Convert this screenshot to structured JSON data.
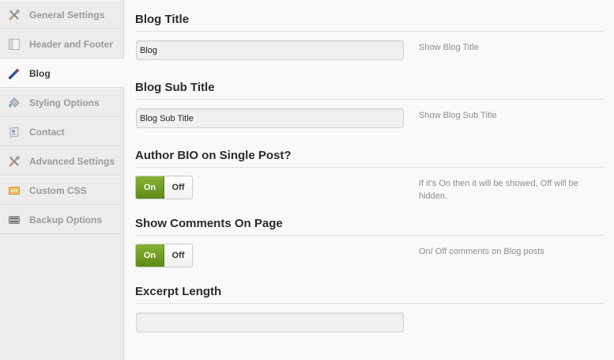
{
  "sidebar": {
    "items": [
      {
        "label": "General Settings",
        "icon": "tools-icon",
        "active": false
      },
      {
        "label": "Header and Footer",
        "icon": "layout-icon",
        "active": false
      },
      {
        "label": "Blog",
        "icon": "pen-icon",
        "active": true
      },
      {
        "label": "Styling Options",
        "icon": "paint-bucket-icon",
        "active": false
      },
      {
        "label": "Contact",
        "icon": "contact-card-icon",
        "active": false
      },
      {
        "label": "Advanced Settings",
        "icon": "tools-icon",
        "active": false
      },
      {
        "label": "Custom CSS",
        "icon": "css-file-icon",
        "active": false
      },
      {
        "label": "Backup Options",
        "icon": "drive-icon",
        "active": false
      }
    ]
  },
  "main": {
    "blog_title": {
      "heading": "Blog Title",
      "value": "Blog",
      "help": "Show Blog Title"
    },
    "blog_sub_title": {
      "heading": "Blog Sub Title",
      "value": "Blog Sub Title",
      "help": "Show Blog Sub Title"
    },
    "author_bio": {
      "heading": "Author BIO on Single Post?",
      "on_label": "On",
      "off_label": "Off",
      "state": "on",
      "help": "If it's On then it will be showed, Off will be hidden."
    },
    "show_comments": {
      "heading": "Show Comments On Page",
      "on_label": "On",
      "off_label": "Off",
      "state": "on",
      "help": "On/ Off comments on Blog posts"
    },
    "excerpt_length": {
      "heading": "Excerpt Length",
      "value": ""
    }
  },
  "colors": {
    "toggle_on": "#6f9c1f",
    "sidebar_bg": "#ececec",
    "content_bg": "#f9f9f9"
  }
}
